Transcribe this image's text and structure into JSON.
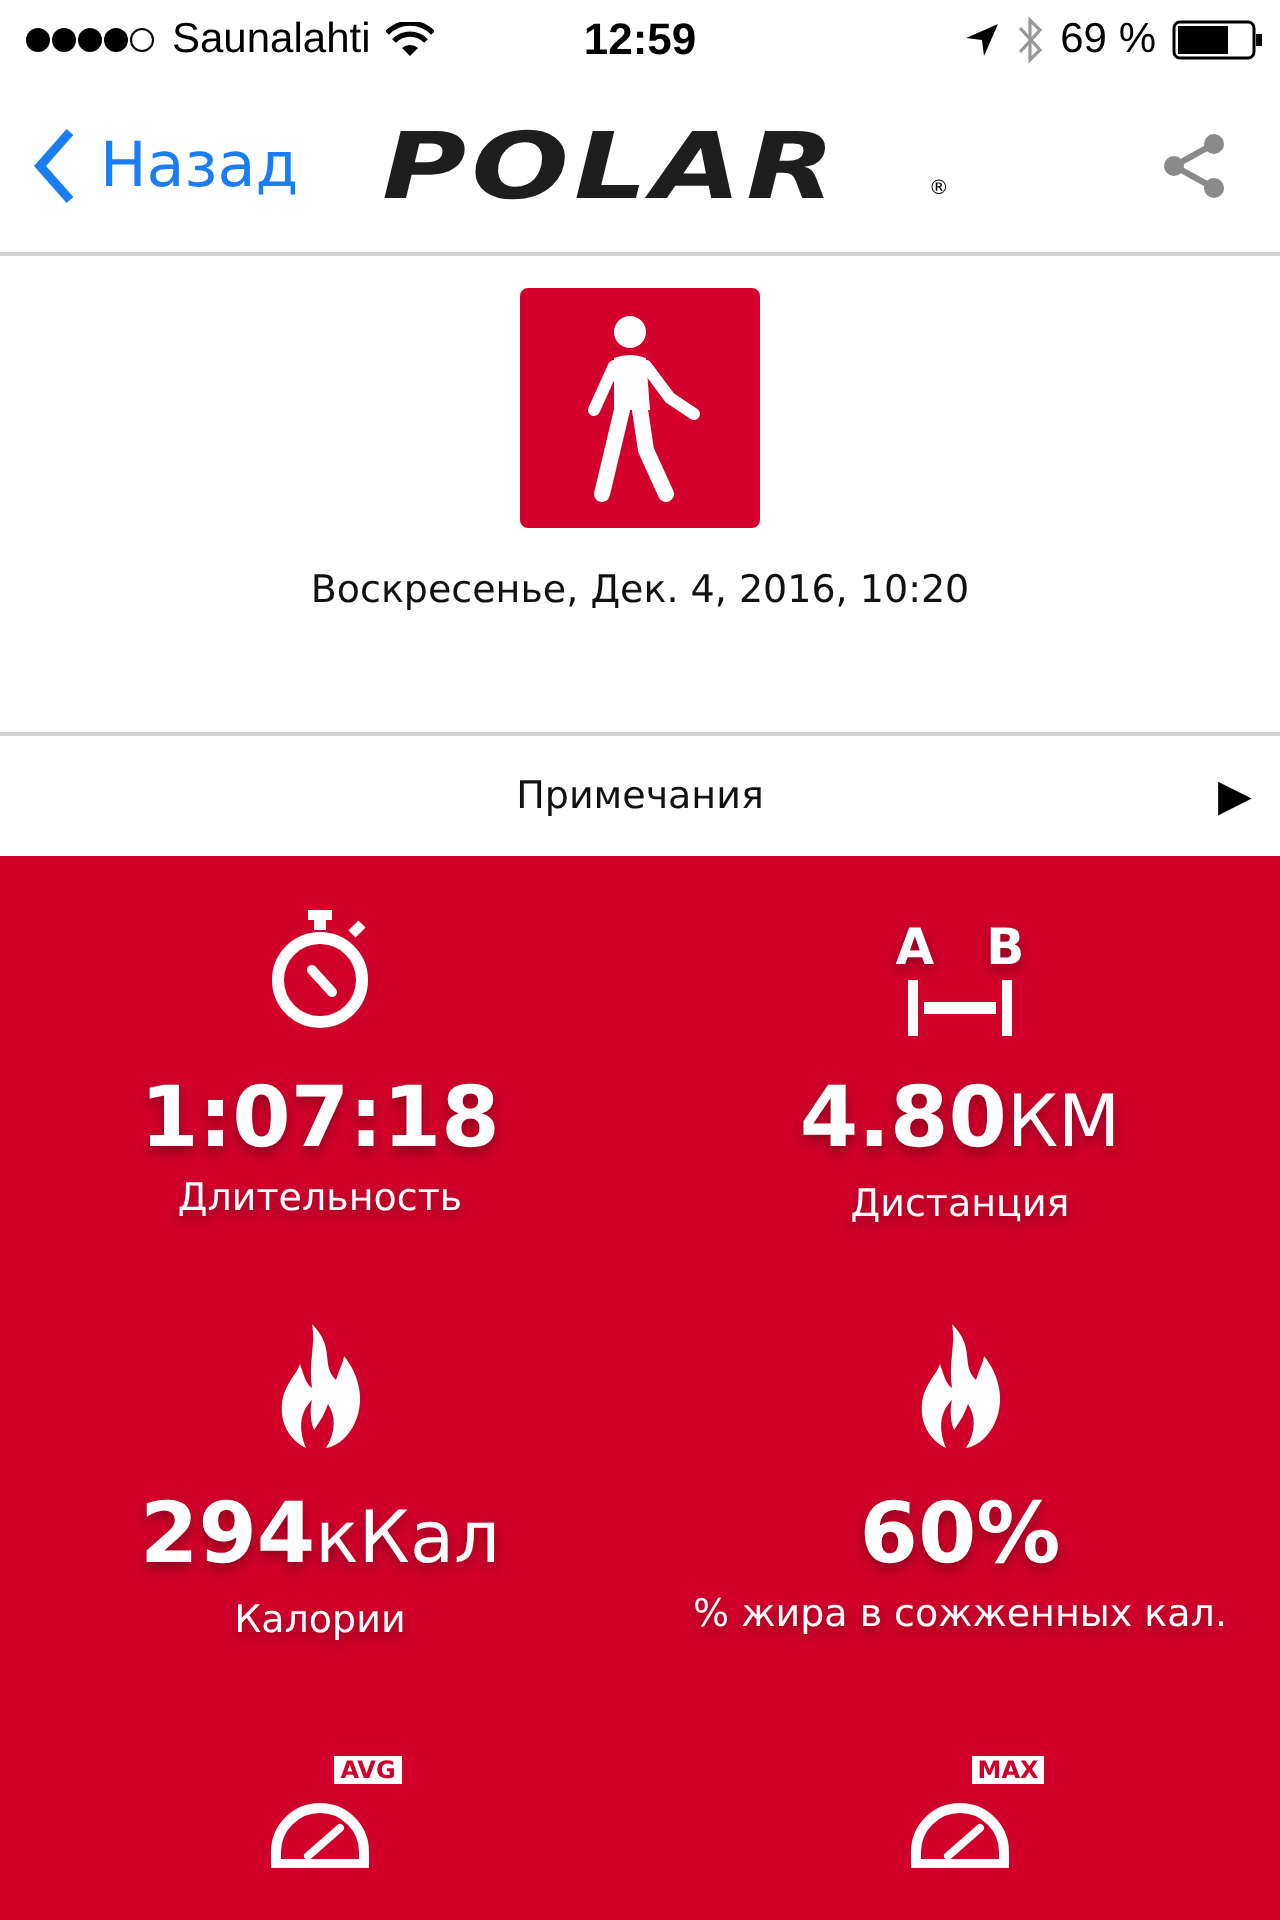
{
  "status_bar": {
    "carrier": "Saunalahti",
    "time": "12:59",
    "battery": "69 %"
  },
  "nav": {
    "back": "Назад",
    "logo": "POLAR",
    "registered": "®"
  },
  "activity": {
    "date": "Воскресенье, Дек. 4, 2016, 10:20"
  },
  "notes": {
    "label": "Примечания",
    "arrow": "▶"
  },
  "stats": [
    {
      "kind": "stopwatch",
      "value": "1:07:18",
      "label": "Длительность"
    },
    {
      "kind": "distance",
      "value": "4.80",
      "unit": "КМ",
      "label": "Дистанция",
      "icon_letters": [
        "A",
        "B"
      ]
    },
    {
      "kind": "flame",
      "value": "294",
      "unit": "кКал",
      "label": "Калории"
    },
    {
      "kind": "flame",
      "value": "60%",
      "label": "% жира в сожженных кал."
    },
    {
      "kind": "gauge",
      "badge": "AVG"
    },
    {
      "kind": "gauge",
      "badge": "MAX"
    }
  ]
}
